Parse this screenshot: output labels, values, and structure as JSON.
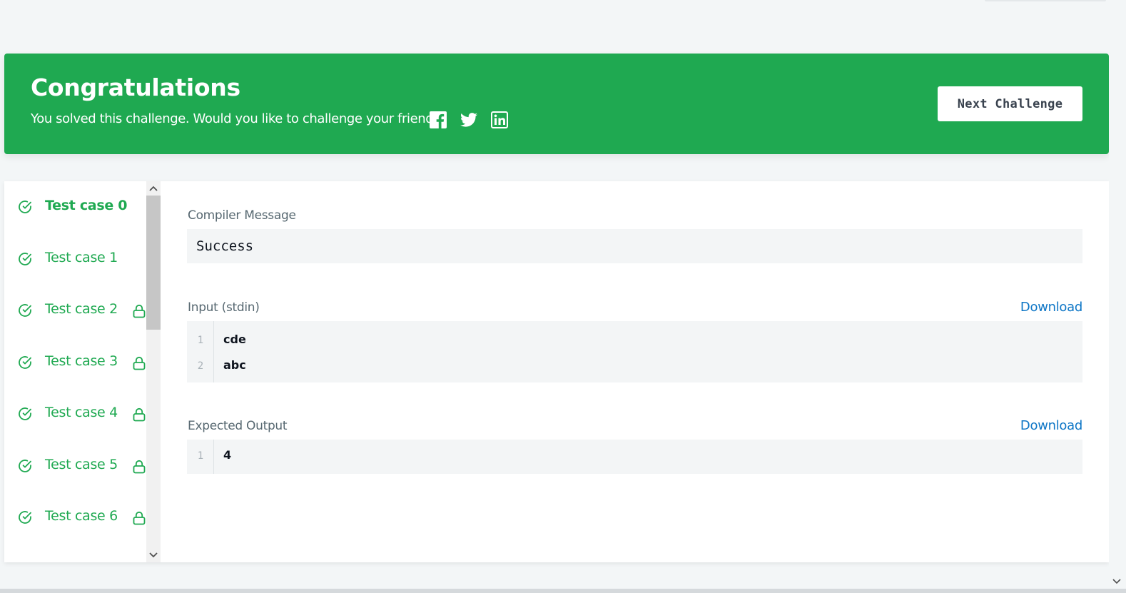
{
  "banner": {
    "title": "Congratulations",
    "subtitle": "You solved this challenge. Would you like to challenge your friends?",
    "social_icons": [
      "facebook-icon",
      "twitter-icon",
      "linkedin-icon"
    ],
    "next_button": "Next Challenge",
    "color": "#1fa951"
  },
  "test_cases": [
    {
      "label": "Test case 0",
      "passed": true,
      "locked": false,
      "active": true
    },
    {
      "label": "Test case 1",
      "passed": true,
      "locked": false,
      "active": false
    },
    {
      "label": "Test case 2",
      "passed": true,
      "locked": true,
      "active": false
    },
    {
      "label": "Test case 3",
      "passed": true,
      "locked": true,
      "active": false
    },
    {
      "label": "Test case 4",
      "passed": true,
      "locked": true,
      "active": false
    },
    {
      "label": "Test case 5",
      "passed": true,
      "locked": true,
      "active": false
    },
    {
      "label": "Test case 6",
      "passed": true,
      "locked": true,
      "active": false
    }
  ],
  "compiler": {
    "label": "Compiler Message",
    "message": "Success"
  },
  "input": {
    "label": "Input (stdin)",
    "download": "Download",
    "lines": [
      {
        "no": "1",
        "text": "cde"
      },
      {
        "no": "2",
        "text": "abc"
      }
    ]
  },
  "expected": {
    "label": "Expected Output",
    "download": "Download",
    "lines": [
      {
        "no": "1",
        "text": "4"
      }
    ]
  },
  "colors": {
    "success": "#1fa951",
    "link": "#0e76c6",
    "code_bg": "#f3f5f6"
  }
}
